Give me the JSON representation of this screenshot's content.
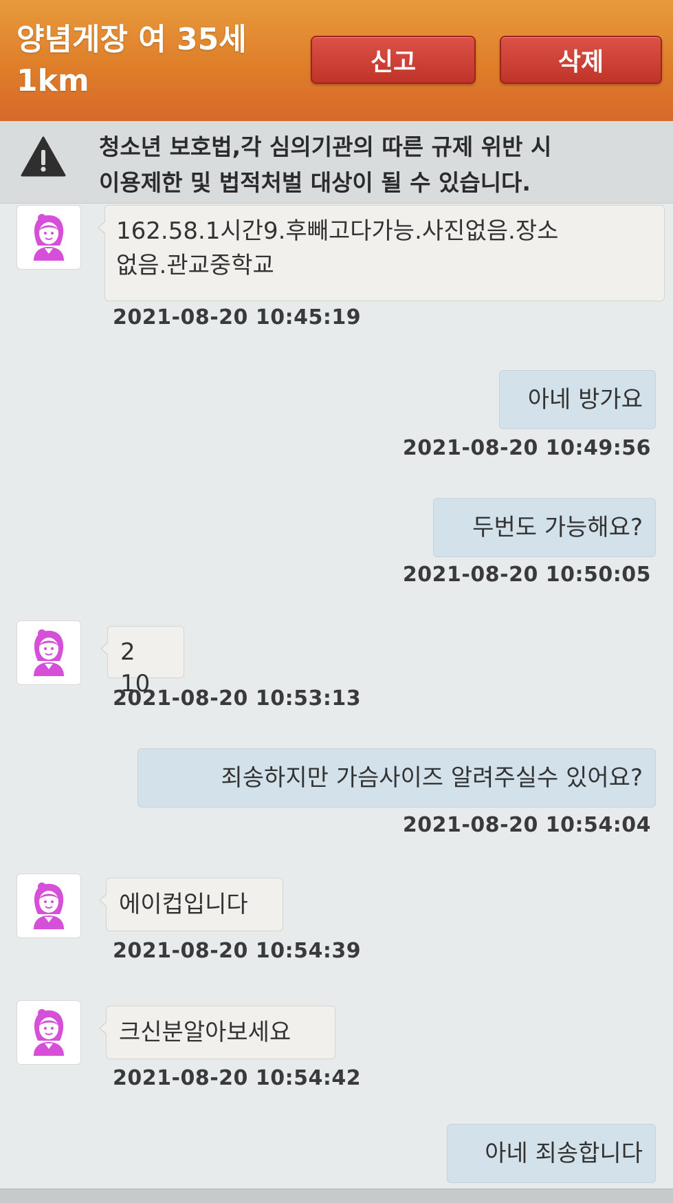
{
  "header": {
    "title_line1": "양념게장 여 35세",
    "title_line2": "1km",
    "report_label": "신고",
    "delete_label": "삭제"
  },
  "notice": {
    "icon": "warning-icon",
    "text_line1": "청소년 보호법,각 심의기관의 따른 규제 위반 시",
    "text_line2": "이용제한 및 법적처벌 대상이 될 수  있습니다."
  },
  "messages": [
    {
      "dir": "in",
      "text_line1": "162.58.1시간9.후빼고다가능.사진없음.장소",
      "text_line2": "없음.관교중학교",
      "time": "2021-08-20 10:45:19"
    },
    {
      "dir": "out",
      "text": "아네 방가요",
      "time": "2021-08-20 10:49:56"
    },
    {
      "dir": "out",
      "text": "두번도 가능해요?",
      "time": "2021-08-20 10:50:05"
    },
    {
      "dir": "in",
      "text": "2 10",
      "time": "2021-08-20 10:53:13"
    },
    {
      "dir": "out",
      "text": "죄송하지만 가슴사이즈 알려주실수 있어요?",
      "time": "2021-08-20 10:54:04"
    },
    {
      "dir": "in",
      "text": "에이컵입니다",
      "time": "2021-08-20 10:54:39"
    },
    {
      "dir": "in",
      "text": "크신분알아보세요",
      "time": "2021-08-20 10:54:42"
    },
    {
      "dir": "out",
      "text": "아네 죄송합니다",
      "time": ""
    }
  ],
  "colors": {
    "header": "#df7e2a",
    "button": "#c7392d",
    "incoming_bubble": "#f1f0ec",
    "outgoing_bubble": "#d3e2ea",
    "avatar_accent": "#d64fd8"
  }
}
